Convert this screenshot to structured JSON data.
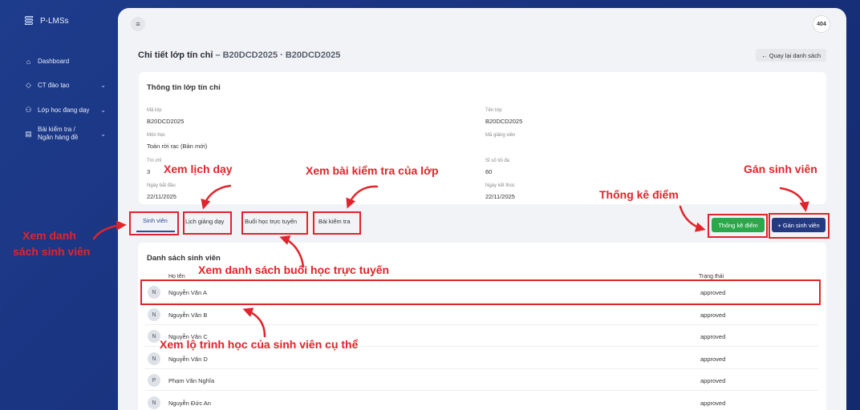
{
  "app": {
    "name": "P-LMSs",
    "user_badge": "404"
  },
  "sidebar": {
    "items": [
      {
        "label": "Dashboard",
        "icon": "home-icon",
        "has_chevron": false
      },
      {
        "label": "CT đào tạo",
        "icon": "graduation-cap-icon",
        "has_chevron": true
      },
      {
        "label": "Lớp học đang dạy",
        "icon": "users-icon",
        "has_chevron": true
      },
      {
        "label_line1": "Bài kiểm tra /",
        "label_line2": "Ngân hàng đề",
        "icon": "document-icon",
        "has_chevron": true
      }
    ]
  },
  "header": {
    "title": "Chi tiết lớp tín chỉ",
    "subtitle": "– B20DCD2025 · B20DCD2025",
    "back_label": "← Quay lại danh sách"
  },
  "info": {
    "title": "Thông tin lớp tín chỉ",
    "fields": {
      "ma_lop": {
        "label": "Mã lớp",
        "value": "B20DCD2025"
      },
      "ten_lop": {
        "label": "Tên lớp",
        "value": "B20DCD2025"
      },
      "mon_hoc": {
        "label": "Môn học",
        "value": "Toán rời rạc (Bản mới)"
      },
      "ma_gv": {
        "label": "Mã giảng viên",
        "value": ""
      },
      "tin_chi": {
        "label": "Tín chỉ",
        "value": "3"
      },
      "si_so": {
        "label": "Sĩ số tối đa",
        "value": "60"
      },
      "ngay_bd": {
        "label": "Ngày bắt đầu",
        "value": "22/11/2025"
      },
      "ngay_kt": {
        "label": "Ngày kết thúc",
        "value": "22/11/2025"
      }
    }
  },
  "tabs": [
    "Sinh viên",
    "Lịch giảng dạy",
    "Buổi học trực tuyến",
    "Bài kiểm tra"
  ],
  "actions": {
    "stats": "Thống kê điểm",
    "assign": "+ Gán sinh viên"
  },
  "students": {
    "title": "Danh sách sinh viên",
    "col_name": "Họ tên",
    "col_status": "Trạng thái",
    "rows": [
      {
        "initial": "N",
        "name": "Nguyễn Văn A",
        "status": "approved"
      },
      {
        "initial": "N",
        "name": "Nguyễn Văn B",
        "status": "approved"
      },
      {
        "initial": "N",
        "name": "Nguyễn Văn C",
        "status": "approved"
      },
      {
        "initial": "N",
        "name": "Nguyễn Văn D",
        "status": "approved"
      },
      {
        "initial": "P",
        "name": "Phạm Văn Nghĩa",
        "status": "approved"
      },
      {
        "initial": "N",
        "name": "Nguyễn Đức An",
        "status": "approved"
      }
    ]
  },
  "annotations": {
    "lich_day": "Xem lịch dạy",
    "bai_kiem_tra": "Xem bài kiểm tra của lớp",
    "gan_sv": "Gán sinh viên",
    "thong_ke": "Thống kê điểm",
    "ds_sv_1": "Xem danh",
    "ds_sv_2": "sách sinh viên",
    "buoi_hoc": "Xem danh sách buổi học trực tuyến",
    "lo_trinh": "Xem lộ trình học của sinh viên cụ thể"
  },
  "colors": {
    "annotation": "#e0242b",
    "accent": "#233a82",
    "success": "#2aa84a"
  }
}
